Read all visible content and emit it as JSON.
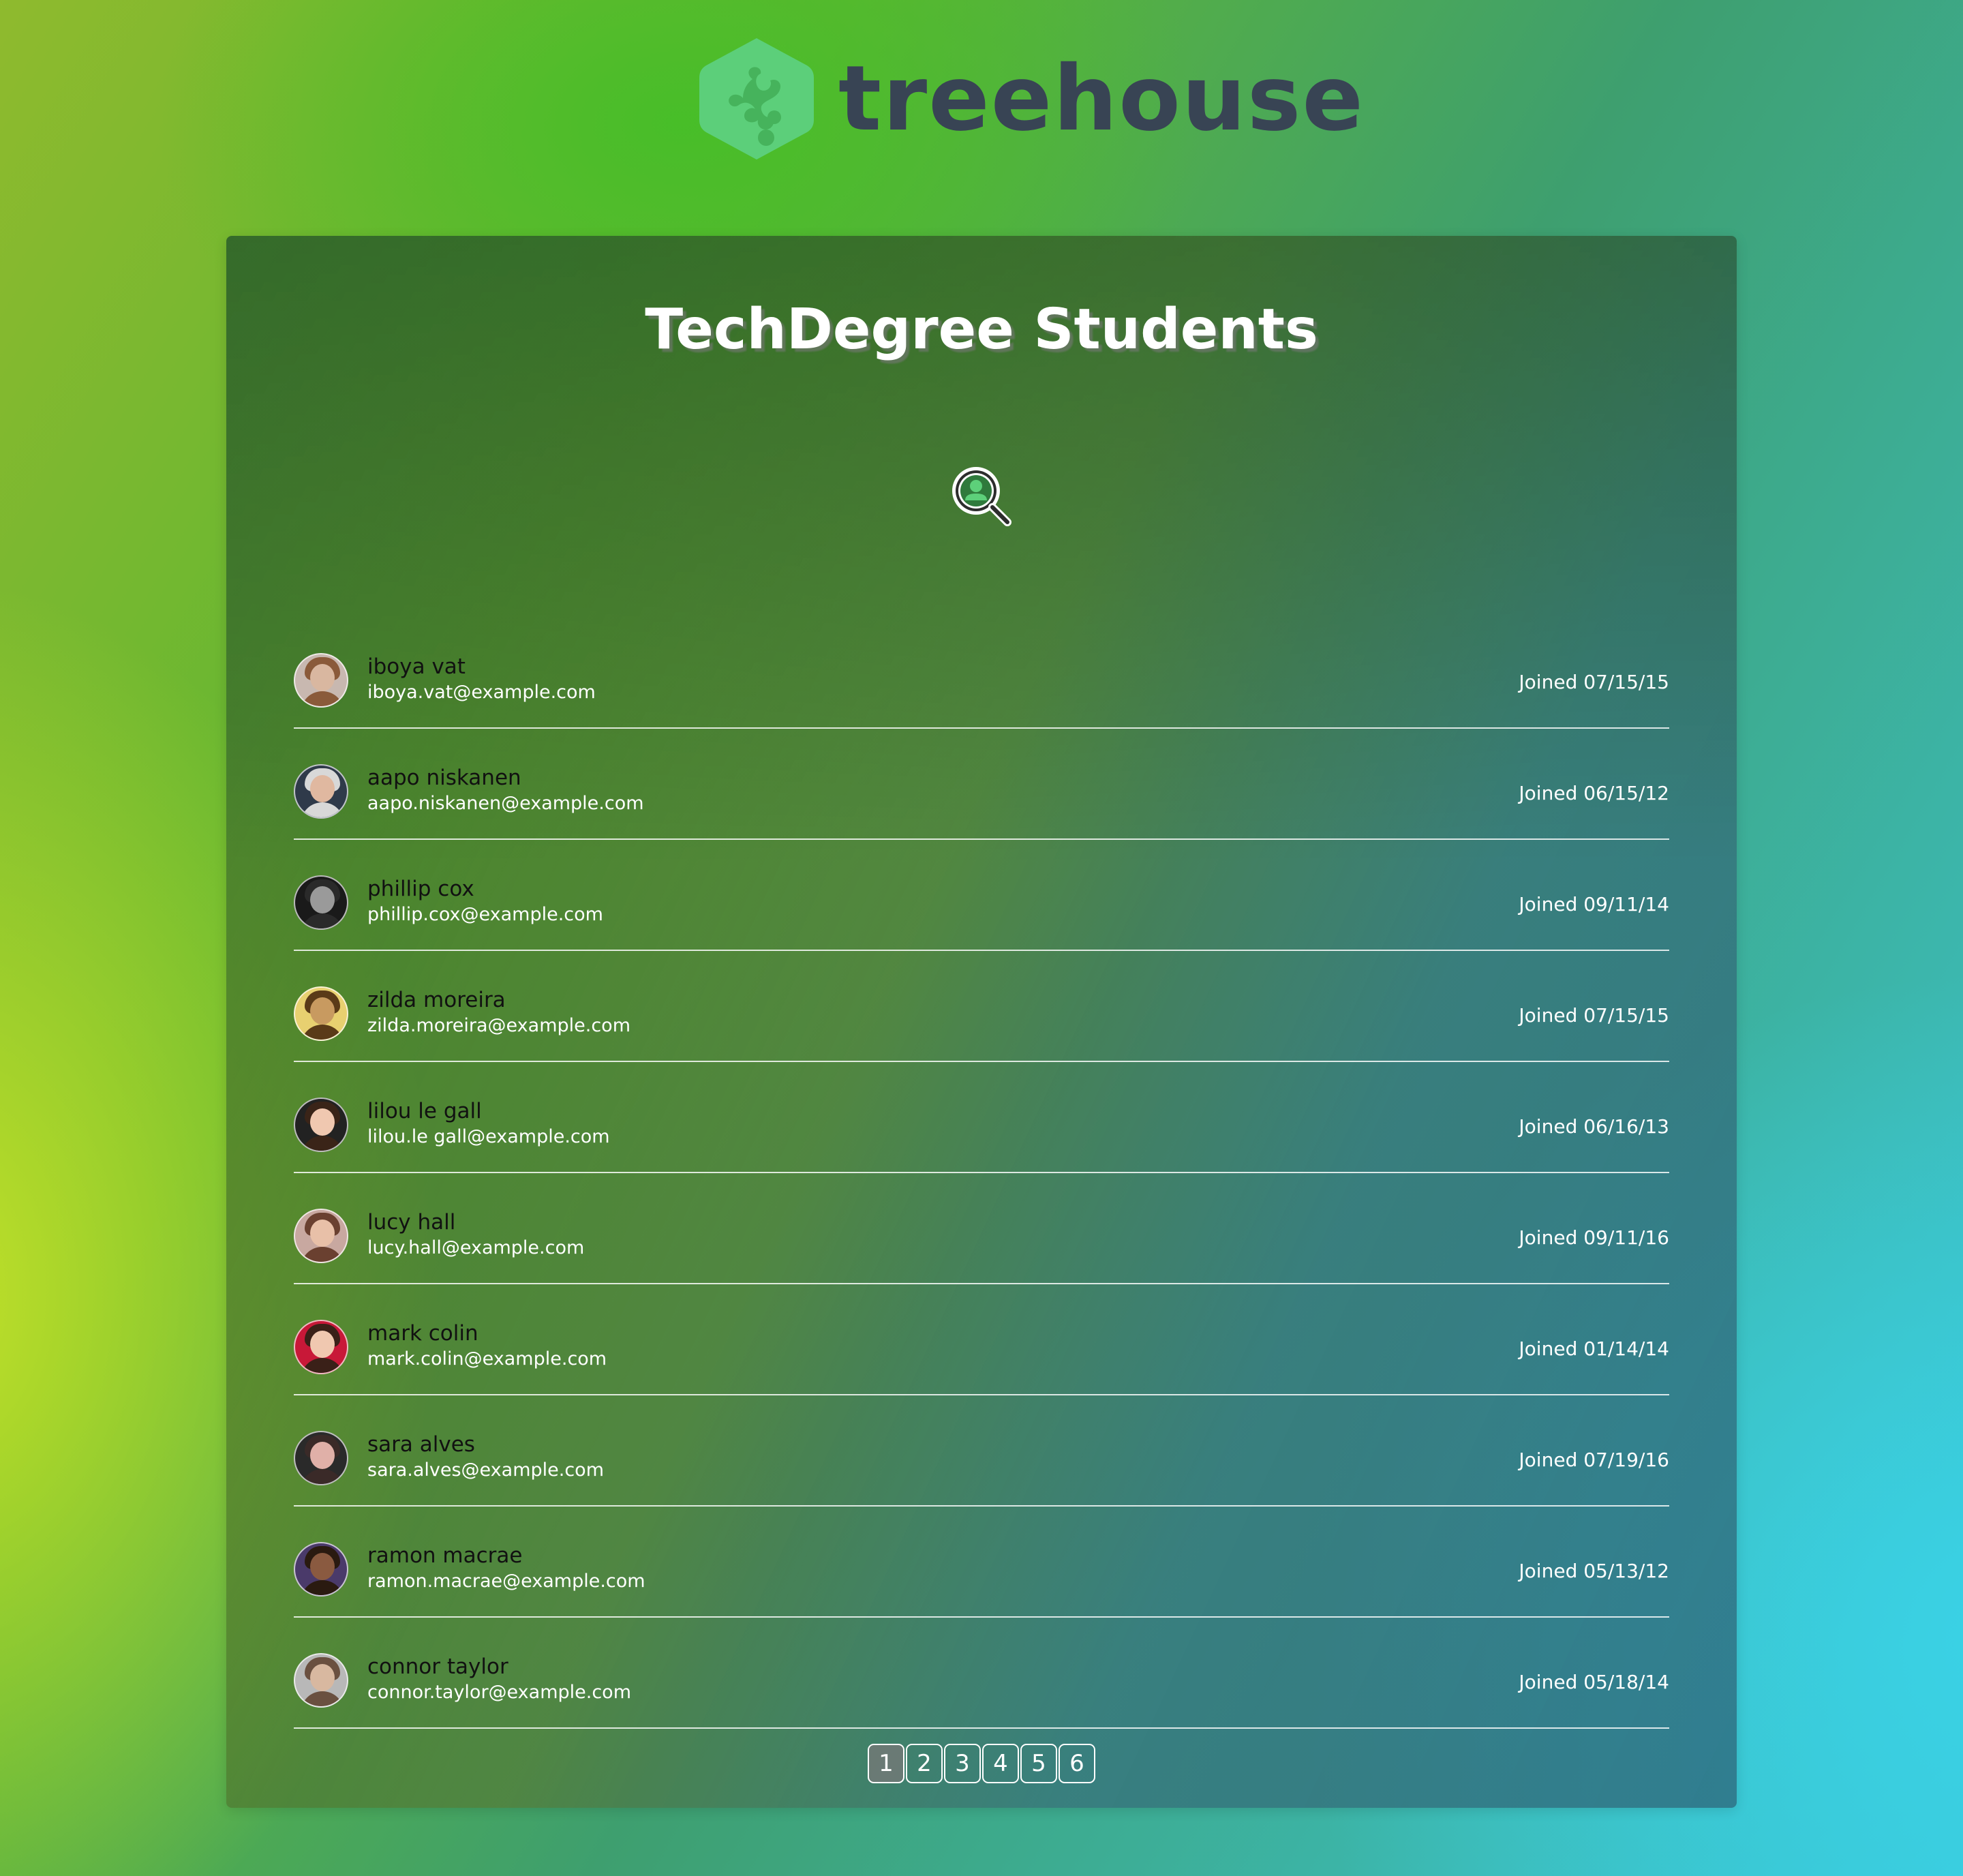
{
  "brand": {
    "name": "treehouse"
  },
  "header": {
    "title": "TechDegree Students"
  },
  "search": {
    "icon": "user-search-icon"
  },
  "students": [
    {
      "name": "iboya vat",
      "email": "iboya.vat@example.com",
      "joined": "Joined 07/15/15",
      "avatar_colors": [
        "#d9b7a0",
        "#8a5a3a",
        "#c8b8b0"
      ]
    },
    {
      "name": "aapo niskanen",
      "email": "aapo.niskanen@example.com",
      "joined": "Joined 06/15/12",
      "avatar_colors": [
        "#e0b8a0",
        "#d8d8d8",
        "#2f3a4a"
      ]
    },
    {
      "name": "phillip cox",
      "email": "phillip.cox@example.com",
      "joined": "Joined 09/11/14",
      "avatar_colors": [
        "#9a9a9a",
        "#2a2a2a",
        "#1a1a1a"
      ]
    },
    {
      "name": "zilda moreira",
      "email": "zilda.moreira@example.com",
      "joined": "Joined 07/15/15",
      "avatar_colors": [
        "#c89a60",
        "#5a3a18",
        "#e8d070"
      ]
    },
    {
      "name": "lilou le gall",
      "email": "lilou.le gall@example.com",
      "joined": "Joined 06/16/13",
      "avatar_colors": [
        "#f0c8b0",
        "#3a2418",
        "#222222"
      ]
    },
    {
      "name": "lucy hall",
      "email": "lucy.hall@example.com",
      "joined": "Joined 09/11/16",
      "avatar_colors": [
        "#e8c0a8",
        "#6a4030",
        "#c8a8a0"
      ]
    },
    {
      "name": "mark colin",
      "email": "mark.colin@example.com",
      "joined": "Joined 01/14/14",
      "avatar_colors": [
        "#f0c8b0",
        "#3a2018",
        "#c81838"
      ]
    },
    {
      "name": "sara alves",
      "email": "sara.alves@example.com",
      "joined": "Joined 07/19/16",
      "avatar_colors": [
        "#e0b0a8",
        "#3a2a28",
        "#2a2a2a"
      ]
    },
    {
      "name": "ramon macrae",
      "email": "ramon.macrae@example.com",
      "joined": "Joined 05/13/12",
      "avatar_colors": [
        "#8a5a40",
        "#2a1a10",
        "#4a3a6a"
      ]
    },
    {
      "name": "connor taylor",
      "email": "connor.taylor@example.com",
      "joined": "Joined 05/18/14",
      "avatar_colors": [
        "#d8b8a0",
        "#6a5040",
        "#b8b8b8"
      ]
    }
  ],
  "pagination": {
    "pages": [
      "1",
      "2",
      "3",
      "4",
      "5",
      "6"
    ],
    "current": "1"
  },
  "colors": {
    "logo_mark": "#5ccf7a",
    "logo_text": "#384454",
    "title": "#ffffff",
    "name": "#111111",
    "email": "#ffffff"
  }
}
